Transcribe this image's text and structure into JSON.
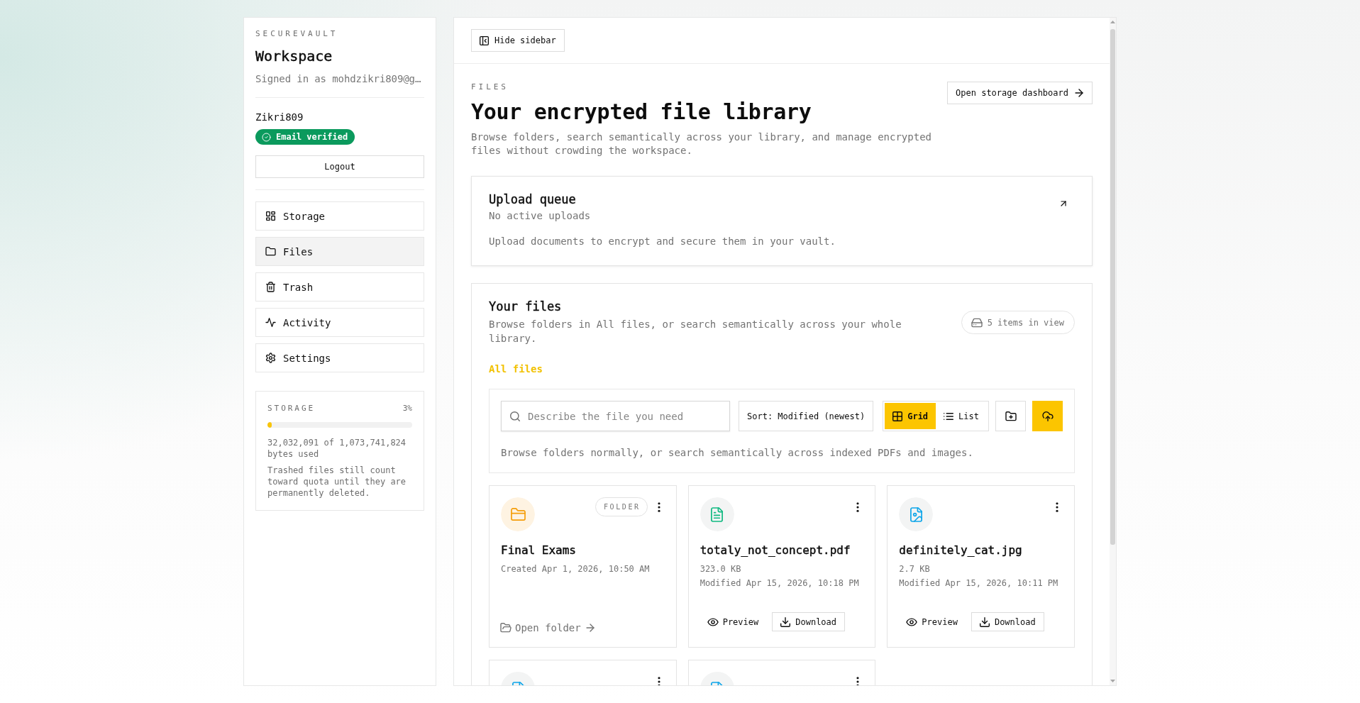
{
  "sidebar": {
    "brand": "SECUREVAULT",
    "title": "Workspace",
    "signed_in": "Signed in as mohdzikri809@g…",
    "username": "Zikri809",
    "email_badge": "Email verified",
    "logout_button": "Logout",
    "nav": [
      {
        "label": "Storage",
        "selected": false
      },
      {
        "label": "Files",
        "selected": true
      },
      {
        "label": "Trash",
        "selected": false
      },
      {
        "label": "Activity",
        "selected": false
      },
      {
        "label": "Settings",
        "selected": false
      }
    ],
    "storage": {
      "label": "STORAGE",
      "percent": "3%",
      "level": 0.03,
      "usage": "32,032,091 of 1,073,741,824 bytes used",
      "note": "Trashed files still count toward quota until they are permanently deleted."
    }
  },
  "topbar": {
    "hide_sidebar_button": "Hide sidebar"
  },
  "header": {
    "eyebrow": "FILES",
    "title": "Your encrypted file library",
    "description": "Browse folders, search semantically across your library, and manage encrypted files without crowding the workspace.",
    "dashboard_button": "Open storage dashboard"
  },
  "upload_queue": {
    "title": "Upload queue",
    "status": "No active uploads",
    "hint": "Upload documents to encrypt and secure them in your vault."
  },
  "files": {
    "title": "Your files",
    "description": "Browse folders in All files, or search semantically across your whole library.",
    "count_badge": "5 items in view",
    "breadcrumb": "All files",
    "search": {
      "placeholder": "Describe the file you need"
    },
    "sort_button": "Sort: Modified (newest)",
    "view_modes": [
      {
        "label": "Grid",
        "selected": true
      },
      {
        "label": "List",
        "selected": false
      }
    ],
    "helper": "Browse folders normally, or search semantically across indexed PDFs and images.",
    "items": [
      {
        "kind": "folder",
        "name": "Final Exams",
        "tag": "FOLDER",
        "meta": [
          "Created Apr 1, 2026, 10:50 AM"
        ],
        "open_link": "Open folder"
      },
      {
        "kind": "pdf",
        "name": "totaly_not_concept.pdf",
        "meta": [
          "323.0 KB",
          "Modified Apr 15, 2026, 10:18 PM"
        ],
        "actions": [
          {
            "kind": "preview",
            "label": "Preview"
          },
          {
            "kind": "download",
            "label": "Download"
          }
        ]
      },
      {
        "kind": "image",
        "name": "definitely_cat.jpg",
        "meta": [
          "2.7 KB",
          "Modified Apr 15, 2026, 10:11 PM"
        ],
        "actions": [
          {
            "kind": "preview",
            "label": "Preview"
          },
          {
            "kind": "download",
            "label": "Download"
          }
        ]
      },
      {
        "kind": "file"
      },
      {
        "kind": "file"
      }
    ]
  }
}
